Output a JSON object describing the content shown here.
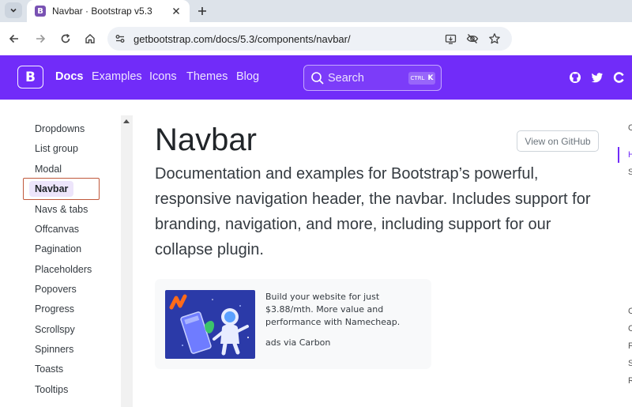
{
  "browser": {
    "tab": {
      "title": "Navbar · Bootstrap v5.3",
      "favicon": "B"
    },
    "address": {
      "url": "getbootstrap.com/docs/5.3/components/navbar/"
    },
    "icons": [
      "tab-search-icon",
      "close-icon",
      "plus-icon",
      "back-icon",
      "forward-icon",
      "reload-icon",
      "home-icon",
      "site-info-icon",
      "install-app-icon",
      "tracking-protection-icon",
      "bookmark-star-icon"
    ]
  },
  "navbar": {
    "brand": "B",
    "links": [
      {
        "label": "Docs",
        "active": true
      },
      {
        "label": "Examples"
      },
      {
        "label": "Icons"
      },
      {
        "label": "Themes"
      },
      {
        "label": "Blog"
      }
    ],
    "search": {
      "label": "Search",
      "kbd_ctrl": "CTRL",
      "kbd_key": "K"
    },
    "social": [
      "github-icon",
      "twitter-icon",
      "opencollective-icon"
    ],
    "color": "#712cf9"
  },
  "sidebar": {
    "items": [
      "Dropdowns",
      "List group",
      "Modal",
      "Navbar",
      "Navs & tabs",
      "Offcanvas",
      "Pagination",
      "Placeholders",
      "Popovers",
      "Progress",
      "Scrollspy",
      "Spinners",
      "Toasts",
      "Tooltips"
    ],
    "active_index": 3,
    "active_bg": "#ede5fb",
    "highlight_color": "#c0583b"
  },
  "main": {
    "title": "Navbar",
    "github_button": "View on GitHub",
    "lead": "Documentation and examples for Bootstrap’s powerful, responsive navigation header, the navbar. Includes support for branding, navigation, and more, including support for our collapse plugin.",
    "ad": {
      "text": "Build your website for just $3.88/mth. More value and performance with Namecheap.",
      "powered_by": "ads via Carbon"
    }
  },
  "toc": {
    "chars": [
      "O",
      "H",
      "S",
      "C",
      "C",
      "F",
      "S",
      "R"
    ]
  }
}
